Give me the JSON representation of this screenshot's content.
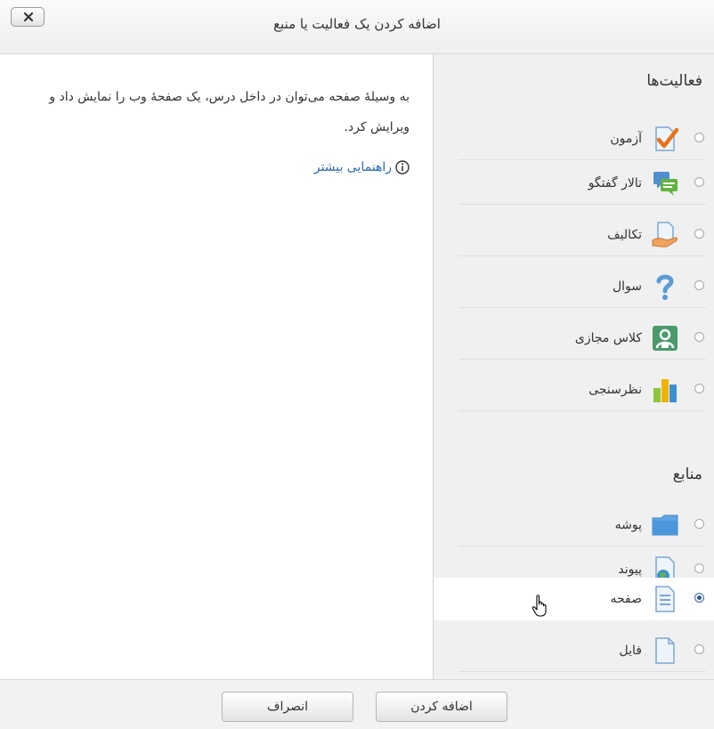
{
  "dialog": {
    "title": "اضافه کردن یک فعالیت یا منبع"
  },
  "sections": {
    "activities": "فعالیت‌ها",
    "resources": "منابع"
  },
  "activities": [
    {
      "label": "آزمون",
      "icon": "quiz-icon"
    },
    {
      "label": "تالار گفتگو",
      "icon": "forum-icon"
    },
    {
      "label": "تکالیف",
      "icon": "assignment-icon"
    },
    {
      "label": "سوال",
      "icon": "question-icon"
    },
    {
      "label": "کلاس مجازی",
      "icon": "virtual-class-icon"
    },
    {
      "label": "نظرسنجی",
      "icon": "survey-icon"
    }
  ],
  "resources": [
    {
      "label": "پوشه",
      "icon": "folder-icon"
    },
    {
      "label": "پیوند",
      "icon": "url-icon"
    },
    {
      "label": "صفحه",
      "icon": "page-icon",
      "selected": true
    },
    {
      "label": "فایل",
      "icon": "file-icon"
    }
  ],
  "description": {
    "text": "به وسیلهٔ صفحه می‌توان در داخل درس، یک صفحهٔ وب را نمایش داد و ویرایش کرد.",
    "help_link": "راهنمایی بیشتر"
  },
  "buttons": {
    "add": "اضافه کردن",
    "cancel": "انصراف"
  },
  "colors": {
    "link": "#2a67b1",
    "panel": "#f0f0f0"
  }
}
